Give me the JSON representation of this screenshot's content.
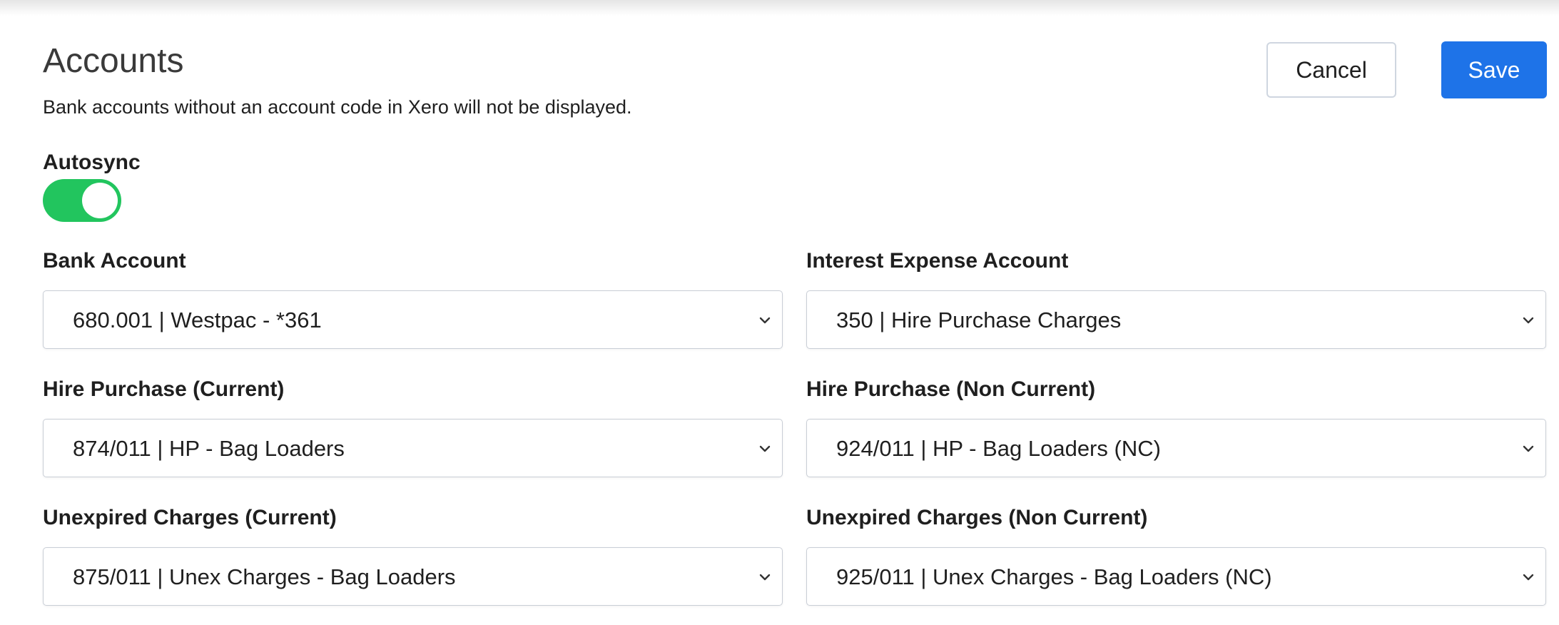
{
  "header": {
    "title": "Accounts",
    "subtitle": "Bank accounts without an account code in Xero will not be displayed.",
    "cancel_label": "Cancel",
    "save_label": "Save"
  },
  "autosync": {
    "label": "Autosync",
    "enabled": true,
    "on_color": "#22c55e"
  },
  "colors": {
    "primary": "#1e73e8"
  },
  "fields": [
    {
      "label": "Bank Account",
      "value": "680.001 | Westpac - *361"
    },
    {
      "label": "Interest Expense Account",
      "value": "350 | Hire Purchase Charges"
    },
    {
      "label": "Hire Purchase (Current)",
      "value": "874/011 | HP - Bag Loaders"
    },
    {
      "label": "Hire Purchase (Non Current)",
      "value": "924/011 | HP - Bag Loaders (NC)"
    },
    {
      "label": "Unexpired Charges (Current)",
      "value": "875/011 | Unex Charges - Bag Loaders"
    },
    {
      "label": "Unexpired Charges (Non Current)",
      "value": "925/011 | Unex Charges - Bag Loaders (NC)"
    }
  ]
}
